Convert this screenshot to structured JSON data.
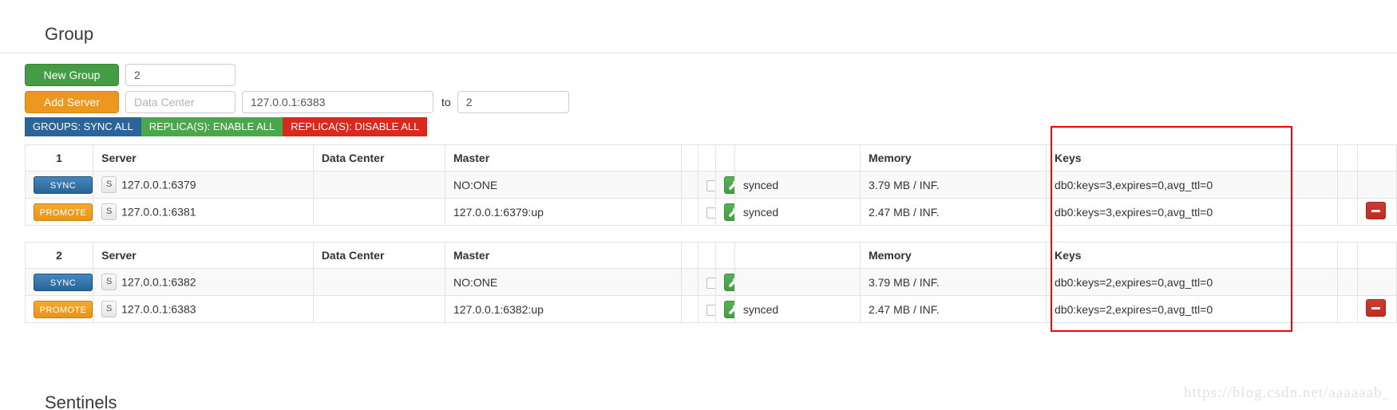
{
  "page": {
    "group_section_title": "Group",
    "sentinels_section_title": "Sentinels",
    "watermark": "https://blog.csdn.net/aaaaaab_"
  },
  "colors": {
    "new_group_green": "#449d44",
    "add_server_orange": "#ec971f",
    "sync_all_blue": "#2b6499",
    "enable_all_green": "#4ca74c",
    "disable_all_red": "#d9291f",
    "sync_button_blue": "#2a6496",
    "promote_button_orange": "#ea9513",
    "wrench_green": "#42a042",
    "delete_red": "#bd2d24",
    "annotation_red": "#ff0000"
  },
  "forms": {
    "new_group": {
      "button_label": "New Group",
      "input_value": "2",
      "input_placeholder": ""
    },
    "add_server": {
      "button_label": "Add Server",
      "datacenter_value": "",
      "datacenter_placeholder": "Data Center",
      "server_value": "127.0.0.1:6383",
      "server_placeholder": "",
      "to_label": "to",
      "group_value": "2",
      "group_placeholder": ""
    }
  },
  "bulk_actions": [
    {
      "label": "GROUPS: SYNC ALL",
      "name": "groups-sync-all-button"
    },
    {
      "label": "REPLICA(S): ENABLE ALL",
      "name": "replicas-enable-all-button"
    },
    {
      "label": "REPLICA(S): DISABLE ALL",
      "name": "replicas-disable-all-button"
    }
  ],
  "table_columns": {
    "server": "Server",
    "data_center": "Data Center",
    "master": "Master",
    "blank1": "",
    "check": "",
    "wrench": "",
    "status": "",
    "memory": "Memory",
    "keys": "Keys",
    "blank2": "",
    "delete": ""
  },
  "groups": [
    {
      "group_number": "1",
      "rows": [
        {
          "action_label": "SYNC",
          "action_type": "sync",
          "badge": "S",
          "server": "127.0.0.1:6379",
          "data_center": "",
          "master": "NO:ONE",
          "checked": false,
          "status": "synced",
          "memory": "3.79 MB / INF.",
          "keys": "db0:keys=3,expires=0,avg_ttl=0",
          "has_delete": false
        },
        {
          "action_label": "PROMOTE",
          "action_type": "promote",
          "badge": "S",
          "server": "127.0.0.1:6381",
          "data_center": "",
          "master": "127.0.0.1:6379:up",
          "checked": false,
          "status": "synced",
          "memory": "2.47 MB / INF.",
          "keys": "db0:keys=3,expires=0,avg_ttl=0",
          "has_delete": true
        }
      ]
    },
    {
      "group_number": "2",
      "rows": [
        {
          "action_label": "SYNC",
          "action_type": "sync",
          "badge": "S",
          "server": "127.0.0.1:6382",
          "data_center": "",
          "master": "NO:ONE",
          "checked": false,
          "status": "",
          "memory": "3.79 MB / INF.",
          "keys": "db0:keys=2,expires=0,avg_ttl=0",
          "has_delete": false
        },
        {
          "action_label": "PROMOTE",
          "action_type": "promote",
          "badge": "S",
          "server": "127.0.0.1:6383",
          "data_center": "",
          "master": "127.0.0.1:6382:up",
          "checked": false,
          "status": "synced",
          "memory": "2.47 MB / INF.",
          "keys": "db0:keys=2,expires=0,avg_ttl=0",
          "has_delete": true
        }
      ]
    }
  ]
}
